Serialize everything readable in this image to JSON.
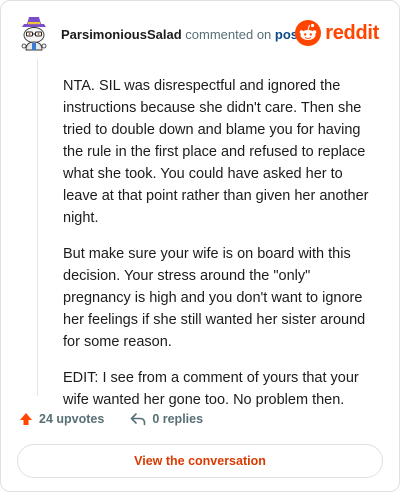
{
  "comment": {
    "username": "ParsimoniousSalad",
    "action_text": "commented on",
    "post_link": "post",
    "paragraphs": [
      "NTA. SIL was disrespectful and ignored the instructions because she didn't care. Then she tried to double down and blame you for having the rule in the first place and refused to replace what she took. You could have asked her to leave at that point rather than given her another night.",
      "But make sure your wife is on board with this decision. Your stress around the \"only\" pregnancy is high and you don't want to ignore her feelings if she still wanted her sister around for some reason.",
      "EDIT: I see from a comment of yours that your wife wanted her gone too. No problem then."
    ],
    "upvotes": "24 upvotes",
    "replies": "0 replies",
    "cta_label": "View the conversation"
  },
  "brand": {
    "wordmark": "reddit",
    "color": "#ff4500"
  },
  "icons": {
    "avatar": "snoo-avatar-icon",
    "logo": "reddit-logo-icon",
    "upvote": "upvote-arrow-icon",
    "reply": "reply-arrow-icon"
  },
  "colors": {
    "accent": "#ff4500",
    "link": "#0b4a8b",
    "muted": "#576f76",
    "cta": "#d93a00"
  }
}
